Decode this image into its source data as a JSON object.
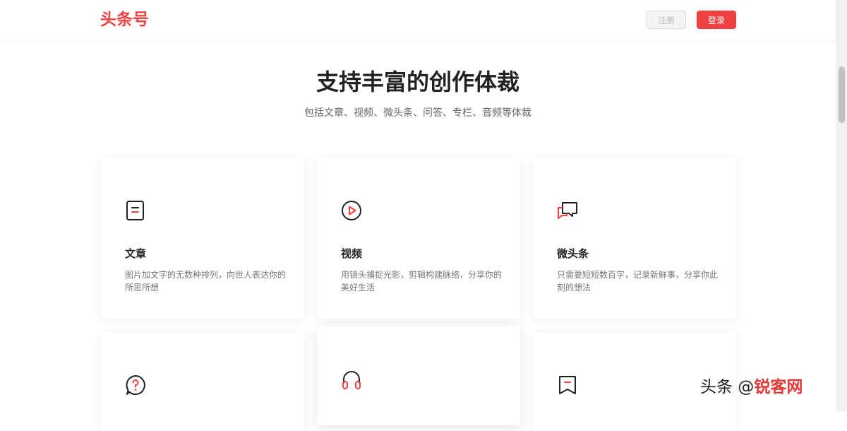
{
  "header": {
    "logo": "头条号",
    "register_label": "注册",
    "login_label": "登录"
  },
  "hero": {
    "title": "支持丰富的创作体裁",
    "subtitle": "包括文章、视频、微头条、问答、专栏、音频等体裁"
  },
  "cards": [
    {
      "icon": "article-icon",
      "title": "文章",
      "desc": "图片加文字的无数种排列，向世人表达你的所思所想"
    },
    {
      "icon": "video-play-icon",
      "title": "视频",
      "desc": "用镜头捕捉光影，剪辑构建脉络，分享你的美好生活"
    },
    {
      "icon": "chat-bubbles-icon",
      "title": "微头条",
      "desc": "只需要短短数百字，记录新鲜事，分享你此刻的想法"
    },
    {
      "icon": "question-bubble-icon"
    },
    {
      "icon": "headphones-icon"
    },
    {
      "icon": "bookmark-icon"
    }
  ],
  "watermark": {
    "prefix": "头条 @",
    "brand": "锐客网"
  },
  "colors": {
    "brand_red": "#f04142",
    "text_dark": "#222222",
    "text_muted": "#777777"
  }
}
